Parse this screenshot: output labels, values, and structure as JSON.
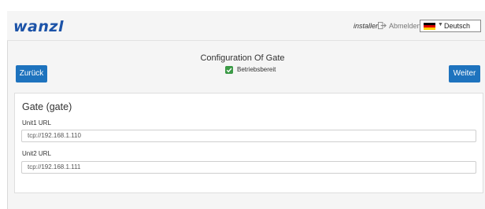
{
  "header": {
    "logo": "wanzl",
    "user": "installer",
    "logout_label": "Abmelden",
    "language": "Deutsch"
  },
  "page": {
    "title": "Configuration Of Gate",
    "status_label": "Betriebsbereit",
    "back_button": "Zurück",
    "next_button": "Weiter"
  },
  "panel": {
    "title": "Gate (gate)",
    "fields": [
      {
        "label": "Unit1 URL",
        "value": "tcp://192.168.1.110"
      },
      {
        "label": "Unit2 URL",
        "value": "tcp://192.168.1.111"
      }
    ]
  },
  "colors": {
    "brand": "#1c53a8",
    "button": "#1e73be",
    "status_ok": "#3c9a47"
  }
}
